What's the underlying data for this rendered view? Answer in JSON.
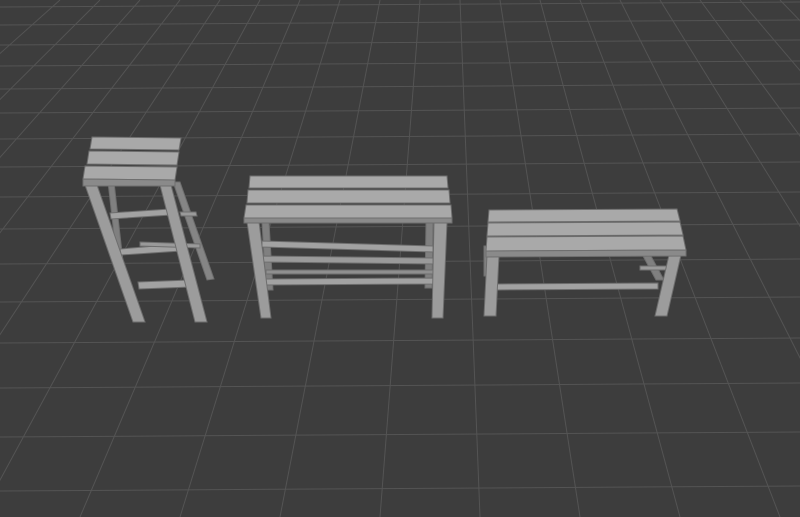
{
  "viewport": {
    "background_color": "#3d3d3d",
    "grid_color": "#545454",
    "grid_line_count_horizontal": 16,
    "grid_line_count_vertical": 22
  },
  "scene": {
    "objects": [
      {
        "name": "tall-stool",
        "kind": "stool",
        "slat_count": 3,
        "material_color": "#9a9a9a"
      },
      {
        "name": "bench-table",
        "kind": "table",
        "slat_count": 3,
        "material_color": "#9a9a9a"
      },
      {
        "name": "low-bench",
        "kind": "bench",
        "slat_count": 3,
        "material_color": "#9a9a9a"
      }
    ]
  }
}
